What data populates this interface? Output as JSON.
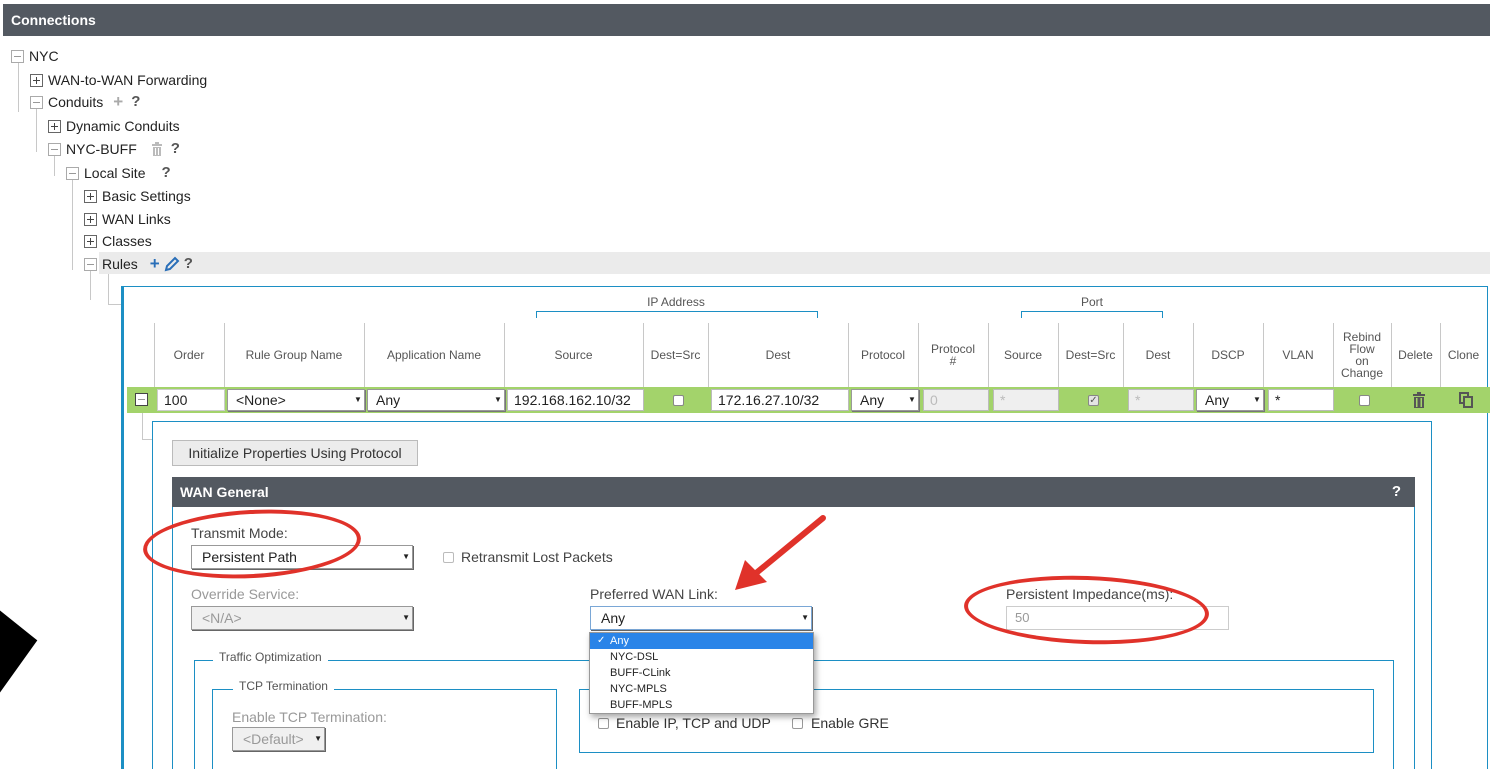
{
  "window": {
    "title": "Connections"
  },
  "tree": {
    "nyc": "NYC",
    "wan_to_wan": "WAN-to-WAN Forwarding",
    "conduits": "Conduits",
    "dynamic_conduits": "Dynamic Conduits",
    "nyc_buff": "NYC-BUFF",
    "local_site": "Local Site",
    "basic_settings": "Basic Settings",
    "wan_links": "WAN Links",
    "classes": "Classes",
    "rules": "Rules",
    "help_symbol": "?",
    "add_symbol": "+"
  },
  "grid": {
    "group_headers": {
      "ip_address": "IP Address",
      "port": "Port"
    },
    "columns": {
      "order": "Order",
      "rule_group": "Rule Group Name",
      "application": "Application Name",
      "ip_source": "Source",
      "ip_dest_src": "Dest=Src",
      "ip_dest": "Dest",
      "protocol": "Protocol",
      "protocol_num_1": "Protocol",
      "protocol_num_2": "#",
      "port_source": "Source",
      "port_dest_src": "Dest=Src",
      "port_dest": "Dest",
      "dscp": "DSCP",
      "vlan": "VLAN",
      "rebind_1": "Rebind",
      "rebind_2": "Flow",
      "rebind_3": "on",
      "rebind_4": "Change",
      "delete": "Delete",
      "clone": "Clone"
    },
    "row": {
      "order": "100",
      "rule_group": "<None>",
      "application": "Any",
      "ip_source": "192.168.162.10/32",
      "ip_dest_src_checked": false,
      "ip_dest": "172.16.27.10/32",
      "protocol": "Any",
      "protocol_num": "0",
      "port_source": "*",
      "port_dest_src_checked": true,
      "port_dest": "*",
      "dscp": "Any",
      "vlan": "*",
      "rebind_checked": false,
      "row_highlight_color": "#a3d36b"
    }
  },
  "detail": {
    "init_button": "Initialize Properties Using Protocol",
    "section_title": "WAN General",
    "section_help": "?",
    "transmit_mode_label": "Transmit Mode:",
    "transmit_mode_value": "Persistent Path",
    "retransmit_label": "Retransmit Lost Packets",
    "override_label": "Override Service:",
    "override_value": "<N/A>",
    "preferred_wan_label": "Preferred WAN Link:",
    "preferred_wan_value": "Any",
    "preferred_wan_options": [
      "Any",
      "NYC-DSL",
      "BUFF-CLink",
      "NYC-MPLS",
      "BUFF-MPLS"
    ],
    "persistent_impedance_label": "Persistent Impedance(ms):",
    "persistent_impedance_value": "50",
    "traffic_opt_legend": "Traffic Optimization",
    "tcp_term_legend": "TCP Termination",
    "enable_tcp_label": "Enable TCP Termination:",
    "enable_tcp_value": "<Default>",
    "enable_ip_tcp_udp": "Enable IP, TCP and UDP",
    "enable_gre": "Enable GRE"
  },
  "colors": {
    "accent": "#1c8fc4",
    "header_bg": "#535961",
    "annotation": "#e0322a",
    "selected_option": "#2a84e8"
  },
  "icons": [
    "minus-toggle-icon",
    "plus-toggle-icon",
    "trash-icon",
    "pencil-icon",
    "clone-icon",
    "help-icon",
    "arrow-annotation",
    "mouse-cursor-icon"
  ]
}
